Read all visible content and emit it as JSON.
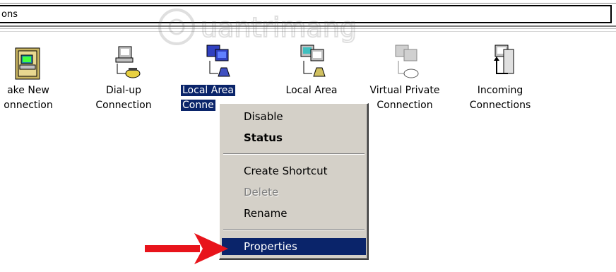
{
  "window": {
    "title_fragment": "ons"
  },
  "watermark_text": "Quantrimang",
  "items": [
    {
      "line1": "ake New",
      "line2": "onnection",
      "icon": "make-new-connection-icon"
    },
    {
      "line1": "Dial-up",
      "line2": "Connection",
      "icon": "dialup-connection-icon"
    },
    {
      "line1": "Local Area",
      "line2": "Conne",
      "icon": "lan-connection-icon"
    },
    {
      "line1": "Local Area",
      "line2": "",
      "icon": "lan-connection-2-icon"
    },
    {
      "line1": "Virtual Private",
      "line2": "Connection",
      "icon": "vpn-connection-icon"
    },
    {
      "line1": "Incoming",
      "line2": "Connections",
      "icon": "incoming-connections-icon"
    }
  ],
  "context_menu": {
    "disable": "Disable",
    "status": "Status",
    "create_shortcut": "Create Shortcut",
    "delete": "Delete",
    "rename": "Rename",
    "properties": "Properties"
  },
  "colors": {
    "selection": "#0a246a",
    "menu_bg": "#d4d0c8",
    "arrow": "#e8141b"
  }
}
